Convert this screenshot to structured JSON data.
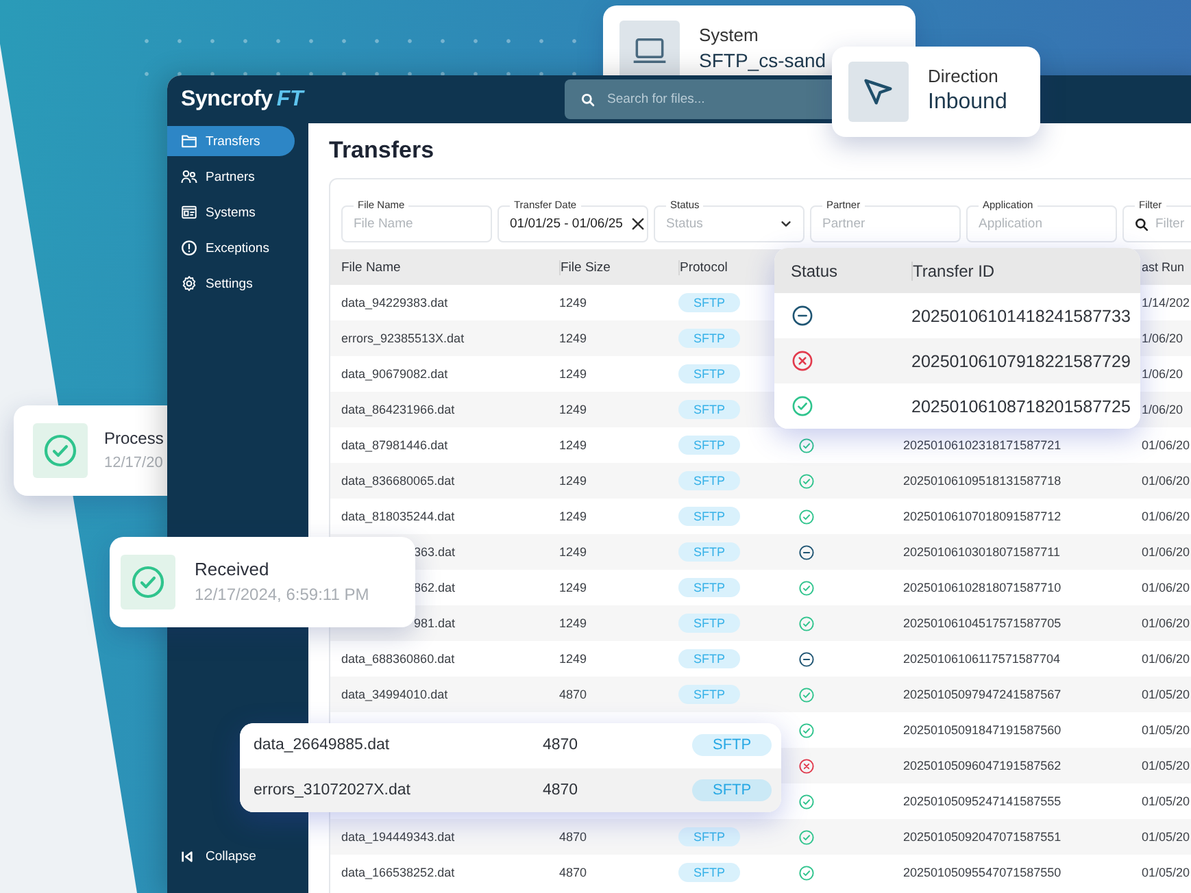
{
  "system_card": {
    "label": "System",
    "value": "SFTP_cs-sand"
  },
  "direction_card": {
    "label": "Direction",
    "value": "Inbound"
  },
  "processed_card": {
    "kind": "success",
    "title": "Process",
    "time": "12/17/20"
  },
  "received_card": {
    "kind": "success",
    "title": "Received",
    "time": "12/17/2024, 6:59:11 PM"
  },
  "header": {
    "logo": {
      "name": "Syncrofy",
      "suffix": "FT"
    },
    "search": {
      "placeholder": "Search for files..."
    }
  },
  "sidebar": {
    "items": [
      {
        "label": "Transfers",
        "selected": true
      },
      {
        "label": "Partners",
        "selected": false
      },
      {
        "label": "Systems",
        "selected": false
      },
      {
        "label": "Exceptions",
        "selected": false
      },
      {
        "label": "Settings",
        "selected": false
      }
    ],
    "collapse": "Collapse"
  },
  "page_title": "Transfers",
  "filters": [
    {
      "kind": "text",
      "label": "File Name",
      "placeholder": "File Name"
    },
    {
      "kind": "date",
      "label": "Transfer Date",
      "value": "01/01/25 - 01/06/25"
    },
    {
      "kind": "select",
      "label": "Status",
      "placeholder": "Status"
    },
    {
      "kind": "text",
      "label": "Partner",
      "placeholder": "Partner"
    },
    {
      "kind": "text",
      "label": "Application",
      "placeholder": "Application"
    },
    {
      "kind": "search",
      "label": "Filter",
      "placeholder": "Filter"
    }
  ],
  "table": {
    "columns": [
      "File Name",
      "File Size",
      "Protocol",
      "ast Run"
    ],
    "rows": [
      {
        "file_name": "data_94229383.dat",
        "file_size": "1249",
        "protocol": "SFTP",
        "last_run": "1/14/202"
      },
      {
        "file_name": "errors_92385513X.dat",
        "file_size": "1249",
        "protocol": "SFTP",
        "last_run": "1/06/20"
      },
      {
        "file_name": "data_90679082.dat",
        "file_size": "1249",
        "protocol": "SFTP",
        "last_run": "1/06/20"
      },
      {
        "file_name": "data_864231966.dat",
        "file_size": "1249",
        "protocol": "SFTP",
        "last_run": "1/06/20"
      },
      {
        "file_name": "data_87981446.dat",
        "file_size": "1249",
        "protocol": "SFTP",
        "kind": "success",
        "transfer_id": "20250106102318171587721",
        "last_run": "01/06/20"
      },
      {
        "file_name": "data_836680065.dat",
        "file_size": "1249",
        "protocol": "SFTP",
        "kind": "success",
        "transfer_id": "20250106109518131587718",
        "last_run": "01/06/20"
      },
      {
        "file_name": "data_818035244.dat",
        "file_size": "1249",
        "protocol": "SFTP",
        "kind": "success",
        "transfer_id": "20250106107018091587712",
        "last_run": "01/06/20"
      },
      {
        "file_name": "363.dat",
        "file_size": "1249",
        "protocol": "SFTP",
        "kind": "pending",
        "transfer_id": "20250106103018071587711",
        "last_run": "01/06/20"
      },
      {
        "file_name": "862.dat",
        "file_size": "1249",
        "protocol": "SFTP",
        "kind": "success",
        "transfer_id": "20250106102818071587710",
        "last_run": "01/06/20"
      },
      {
        "file_name": "981.dat",
        "file_size": "1249",
        "protocol": "SFTP",
        "kind": "success",
        "transfer_id": "20250106104517571587705",
        "last_run": "01/06/20"
      },
      {
        "file_name": "data_688360860.dat",
        "file_size": "1249",
        "protocol": "SFTP",
        "kind": "pending",
        "transfer_id": "20250106106117571587704",
        "last_run": "01/06/20"
      },
      {
        "file_name": "data_34994010.dat",
        "file_size": "4870",
        "protocol": "SFTP",
        "kind": "success",
        "transfer_id": "20250105097947241587567",
        "last_run": "01/05/20"
      },
      {
        "kind": "success",
        "transfer_id": "20250105091847191587560",
        "last_run": "01/05/20"
      },
      {
        "kind": "failed",
        "transfer_id": "20250105096047191587562",
        "last_run": "01/05/20"
      },
      {
        "kind": "success",
        "transfer_id": "20250105095247141587555",
        "last_run": "01/05/20"
      },
      {
        "file_name": "data_194449343.dat",
        "file_size": "4870",
        "protocol": "SFTP",
        "kind": "success",
        "transfer_id": "20250105092047071587551",
        "last_run": "01/05/20"
      },
      {
        "file_name": "data_166538252.dat",
        "file_size": "4870",
        "protocol": "SFTP",
        "kind": "success",
        "transfer_id": "20250105095547071587550",
        "last_run": "01/05/20"
      }
    ]
  },
  "status_popup": {
    "columns": [
      "Status",
      "Transfer ID"
    ],
    "rows": [
      {
        "kind": "pending",
        "transfer_id": "20250106101418241587733"
      },
      {
        "kind": "failed",
        "transfer_id": "20250106107918221587729"
      },
      {
        "kind": "success",
        "transfer_id": "20250106108718201587725"
      }
    ]
  },
  "file_popup": {
    "rows": [
      {
        "file_name": "data_26649885.dat",
        "file_size": "4870",
        "protocol": "SFTP",
        "selected": false
      },
      {
        "file_name": "errors_31072027X.dat",
        "file_size": "4870",
        "protocol": "SFTP",
        "selected": true
      }
    ]
  }
}
